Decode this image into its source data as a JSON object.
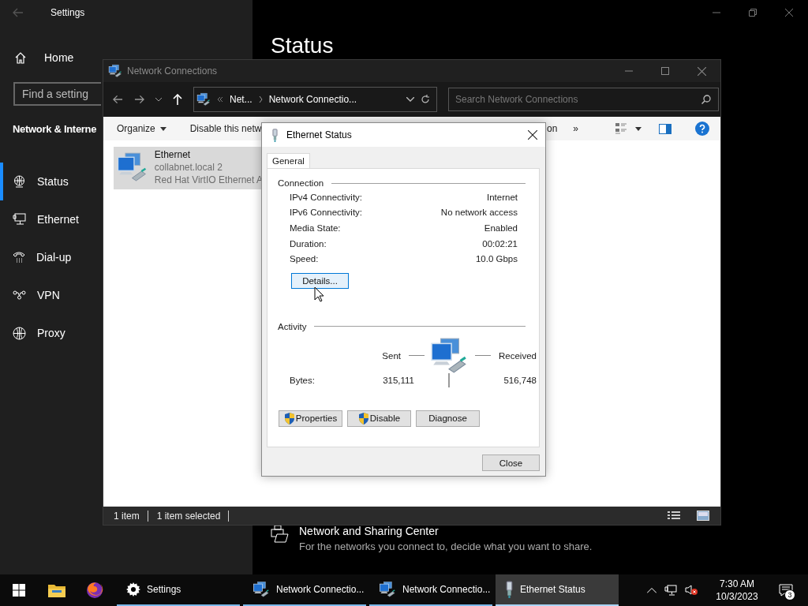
{
  "settings_window": {
    "title": "Settings",
    "home": "Home",
    "search": {
      "placeholder": "Find a setting"
    },
    "section": "Network & Interne",
    "heading": "Status",
    "nav": [
      {
        "label": "Status",
        "kind": "status",
        "selected": true
      },
      {
        "label": "Ethernet",
        "kind": "ethernet",
        "selected": false
      },
      {
        "label": "Dial-up",
        "kind": "dialup",
        "selected": false
      },
      {
        "label": "VPN",
        "kind": "vpn",
        "selected": false
      },
      {
        "label": "Proxy",
        "kind": "proxy",
        "selected": false
      }
    ],
    "sharing_center": {
      "title": "Network and Sharing Center",
      "description": "For the networks you connect to, decide what you want to share."
    }
  },
  "explorer_window": {
    "title": "Network Connections",
    "breadcrumbs": [
      "Net...",
      "Network Connectio..."
    ],
    "search": {
      "placeholder": "Search Network Connections"
    },
    "toolbar_left": [
      {
        "label": "Organize",
        "dropdown": true
      },
      {
        "label": "Disable this netw",
        "dropdown": false
      }
    ],
    "toolbar_right": [
      {
        "label": "on",
        "dropdown": false
      },
      {
        "label": "»",
        "dropdown": false
      }
    ],
    "items": [
      {
        "name": "Ethernet",
        "lines": [
          "collabnet.local 2",
          "Red Hat VirtIO Ethernet A"
        ],
        "selected": true
      }
    ],
    "status_bar": [
      "1 item",
      "1 item selected"
    ]
  },
  "status_dialog": {
    "title": "Ethernet Status",
    "tabs": [
      {
        "label": "General",
        "selected": true
      }
    ],
    "connection": {
      "heading": "Connection",
      "rows": [
        {
          "label": "IPv4 Connectivity:",
          "value": "Internet"
        },
        {
          "label": "IPv6 Connectivity:",
          "value": "No network access"
        },
        {
          "label": "Media State:",
          "value": "Enabled"
        },
        {
          "label": "Duration:",
          "value": "00:02:21"
        },
        {
          "label": "Speed:",
          "value": "10.0 Gbps"
        }
      ]
    },
    "details_button": {
      "label": "Details...",
      "focused": true
    },
    "activity": {
      "heading": "Activity",
      "sent_label": "Sent",
      "received_label": "Received",
      "bytes_label": "Bytes:",
      "sent": "315,111",
      "received": "516,748"
    },
    "buttons": [
      {
        "label": "Properties",
        "shield": true
      },
      {
        "label": "Disable",
        "shield": true
      },
      {
        "label": "Diagnose",
        "shield": false
      }
    ],
    "close_button": "Close"
  },
  "taskbar": {
    "pinned": [
      {
        "kind": "start"
      },
      {
        "kind": "files"
      },
      {
        "kind": "firefox"
      }
    ],
    "apps": [
      {
        "label": "Settings",
        "kind": "settings",
        "selected": false
      },
      {
        "label": "Network Connectio...",
        "kind": "network",
        "selected": false
      },
      {
        "label": "Network Connectio...",
        "kind": "network",
        "selected": false
      },
      {
        "label": "Ethernet Status",
        "kind": "plug",
        "selected": true
      }
    ],
    "time": "7:30 AM",
    "date": "10/3/2023",
    "notifications": "3"
  }
}
